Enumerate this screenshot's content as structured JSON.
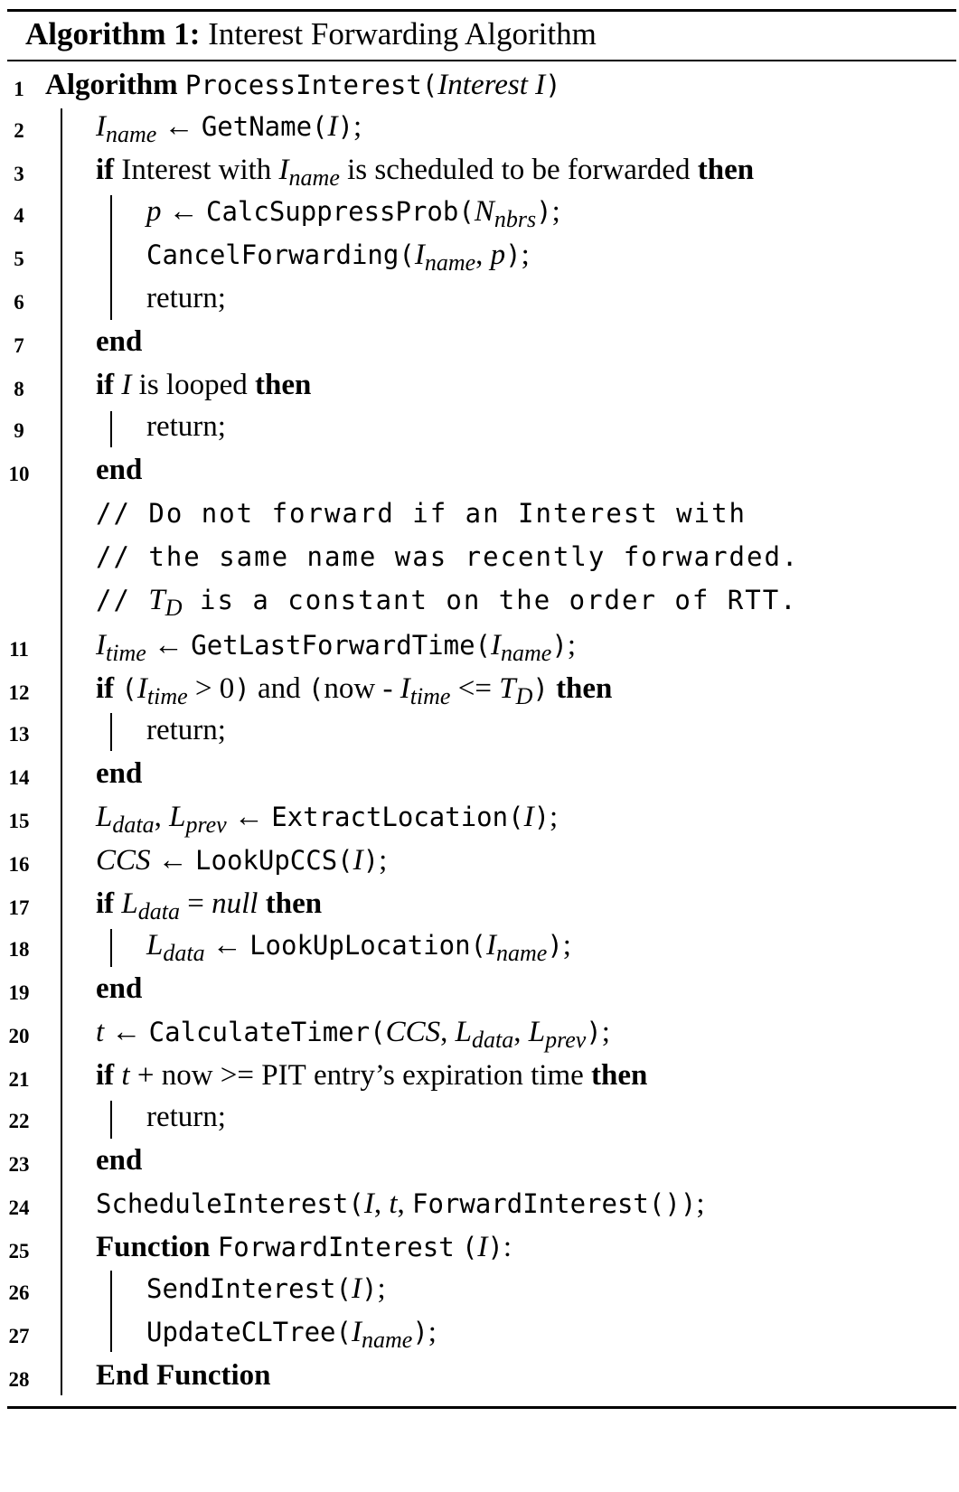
{
  "caption": {
    "label": "Algorithm 1:",
    "title": "Interest Forwarding Algorithm"
  },
  "lines": [
    {
      "num": "1",
      "text": "Algorithm ProcessInterest(Interest I)"
    },
    {
      "num": "2",
      "text": "Iname ← GetName(I);"
    },
    {
      "num": "3",
      "text": "if Interest with Iname is scheduled to be forwarded then"
    },
    {
      "num": "4",
      "text": "p ← CalcSuppressProb(Nnbrs);"
    },
    {
      "num": "5",
      "text": "CancelForwarding(Iname, p);"
    },
    {
      "num": "6",
      "text": "return;"
    },
    {
      "num": "7",
      "text": "end"
    },
    {
      "num": "8",
      "text": "if I is looped then"
    },
    {
      "num": "9",
      "text": "return;"
    },
    {
      "num": "10",
      "text": "end"
    },
    {
      "num": "",
      "text": "// Do not forward if an Interest with"
    },
    {
      "num": "",
      "text": "// the same name was recently forwarded."
    },
    {
      "num": "",
      "text": "// TD is a constant on the order of RTT."
    },
    {
      "num": "11",
      "text": "Itime ← GetLastForwardTime(Iname);"
    },
    {
      "num": "12",
      "text": "if (Itime > 0) and (now - Itime <= TD) then"
    },
    {
      "num": "13",
      "text": "return;"
    },
    {
      "num": "14",
      "text": "end"
    },
    {
      "num": "15",
      "text": "Ldata, Lprev ← ExtractLocation(I);"
    },
    {
      "num": "16",
      "text": "CCS ← LookUpCCS(I);"
    },
    {
      "num": "17",
      "text": "if Ldata = null then"
    },
    {
      "num": "18",
      "text": "Ldata ← LookUpLocation(Iname);"
    },
    {
      "num": "19",
      "text": "end"
    },
    {
      "num": "20",
      "text": "t ← CalculateTimer(CCS, Ldata, Lprev);"
    },
    {
      "num": "21",
      "text": "if t + now >= PIT entry’s expiration time then"
    },
    {
      "num": "22",
      "text": "return;"
    },
    {
      "num": "23",
      "text": "end"
    },
    {
      "num": "24",
      "text": "ScheduleInterest(I, t, ForwardInterest());"
    },
    {
      "num": "25",
      "text": "Function ForwardInterest (I):"
    },
    {
      "num": "26",
      "text": "SendInterest(I);"
    },
    {
      "num": "27",
      "text": "UpdateCLTree(Iname);"
    },
    {
      "num": "28",
      "text": "End Function"
    }
  ]
}
